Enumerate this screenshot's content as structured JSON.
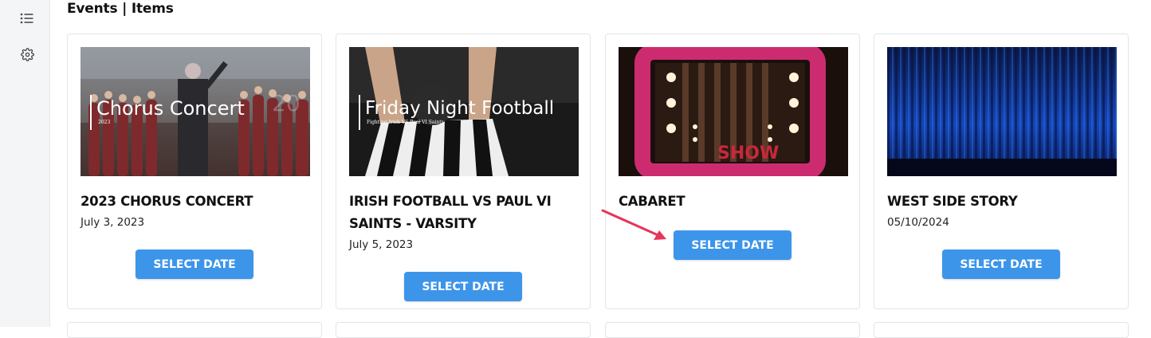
{
  "page": {
    "title": "Events | Items"
  },
  "sidebar": {
    "items": [
      {
        "icon": "list-icon"
      },
      {
        "icon": "gear-icon"
      }
    ]
  },
  "events": [
    {
      "name": "2023 CHORUS CONCERT",
      "date": "July 3, 2023",
      "button_label": "SELECT DATE",
      "image_overlay_title": "Chorus Concert",
      "image_overlay_subtitle": "2023"
    },
    {
      "name": "IRISH FOOTBALL VS PAUL VI SAINTS - VARSITY",
      "date": "July 5, 2023",
      "button_label": "SELECT DATE",
      "image_overlay_title": "Friday Night Football",
      "image_overlay_subtitle": "Fighting Irish VS Paul VI Saints"
    },
    {
      "name": "CABARET",
      "date": "",
      "button_label": "SELECT DATE",
      "image_overlay_title": "SHOW"
    },
    {
      "name": "WEST SIDE STORY",
      "date": "05/10/2024",
      "button_label": "SELECT DATE"
    }
  ],
  "colors": {
    "button": "#3d95ea",
    "annotation_arrow": "#e8345a"
  }
}
